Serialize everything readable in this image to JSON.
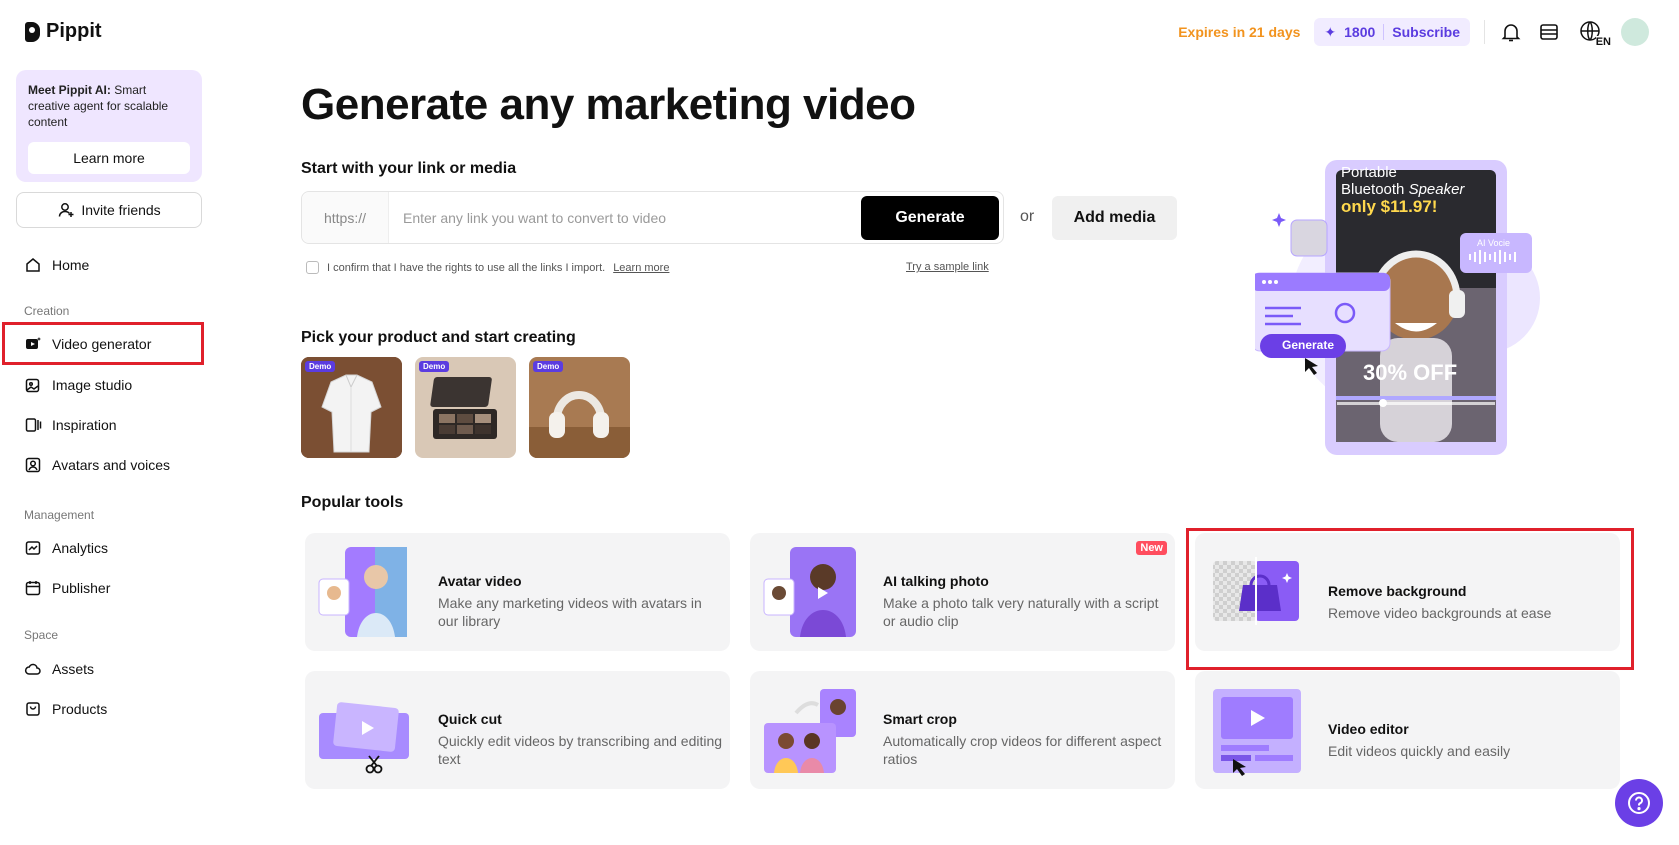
{
  "brand": {
    "name": "Pippit"
  },
  "promo": {
    "bold": "Meet Pippit AI:",
    "text": " Smart creative agent for scalable content",
    "button": "Learn more"
  },
  "invite": {
    "label": "Invite friends"
  },
  "nav": {
    "home": "Home",
    "section_creation": "Creation",
    "video_generator": "Video generator",
    "image_studio": "Image studio",
    "inspiration": "Inspiration",
    "avatars_voices": "Avatars and voices",
    "section_management": "Management",
    "analytics": "Analytics",
    "publisher": "Publisher",
    "section_space": "Space",
    "assets": "Assets",
    "products": "Products"
  },
  "topbar": {
    "expires": "Expires in 21 days",
    "credits": "1800",
    "subscribe": "Subscribe",
    "language": "EN"
  },
  "main": {
    "title": "Generate any marketing video",
    "start_label": "Start with your link or media",
    "link_prefix": "https://",
    "link_placeholder": "Enter any link you want to convert to video",
    "generate": "Generate",
    "or": "or",
    "add_media": "Add media",
    "confirm_text": "I confirm that I have the rights to use all the links I import.",
    "confirm_link": "Learn more",
    "sample_link": "Try a sample link",
    "pick_label": "Pick your product and start creating",
    "demo_tag": "Demo",
    "popular_label": "Popular tools"
  },
  "hero": {
    "line1": "Portable",
    "line2a": "Bluetooth ",
    "line2b": "Speaker",
    "price": "only $11.97!",
    "off": "30% OFF",
    "generate": "Generate",
    "ai_voice": "AI Vocie"
  },
  "tools": [
    {
      "title": "Avatar video",
      "desc": "Make any marketing videos with avatars in our library"
    },
    {
      "title": "AI talking photo",
      "desc": "Make a photo talk very naturally with a script or audio clip",
      "badge": "New"
    },
    {
      "title": "Remove background",
      "desc": "Remove video backgrounds at ease"
    },
    {
      "title": "Quick cut",
      "desc": "Quickly edit videos by transcribing and editing text"
    },
    {
      "title": "Smart crop",
      "desc": "Automatically crop videos for different aspect ratios"
    },
    {
      "title": "Video editor",
      "desc": "Edit videos quickly and easily"
    }
  ],
  "colors": {
    "accent": "#5b3ce0",
    "highlight": "#e0202b",
    "expires": "#f2931e",
    "promo_bg": "#efe6ff"
  }
}
